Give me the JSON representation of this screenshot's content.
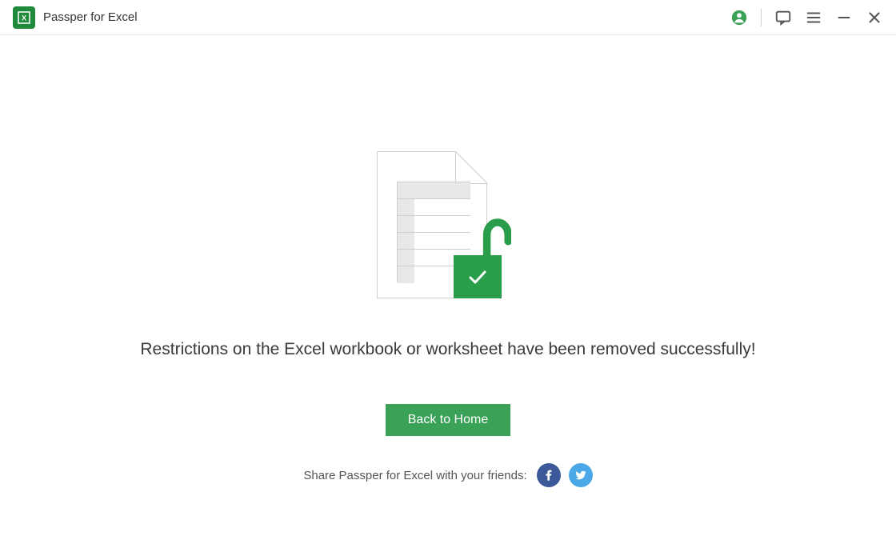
{
  "titlebar": {
    "app_name": "Passper for Excel"
  },
  "content": {
    "success_message": "Restrictions on the Excel workbook or worksheet have been removed successfully!",
    "back_button_label": "Back to Home",
    "share_text": "Share Passper for Excel with your friends:"
  },
  "colors": {
    "accent": "#2a9d4a",
    "button": "#3aa256",
    "facebook": "#3b5998",
    "twitter": "#4aa8e8"
  }
}
